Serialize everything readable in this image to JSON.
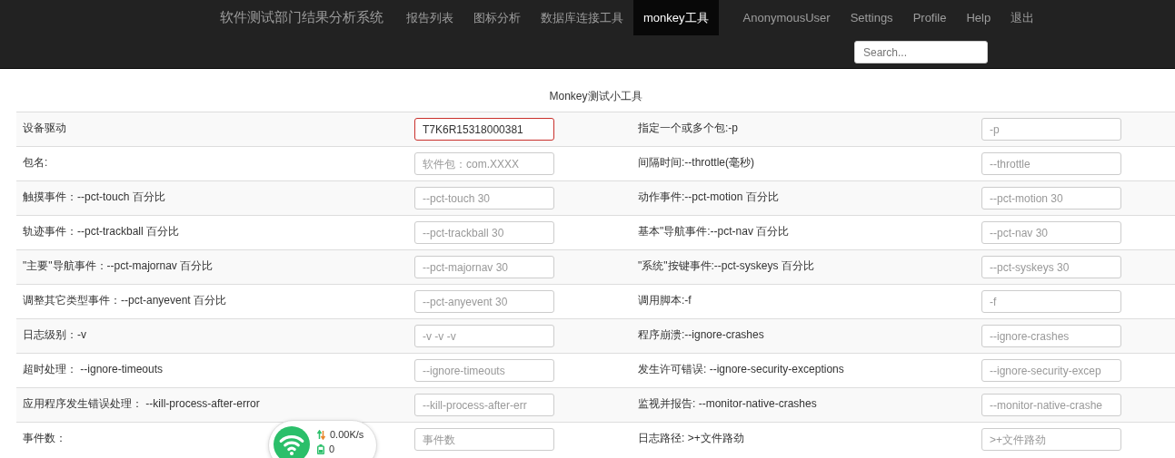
{
  "navbar": {
    "brand": "软件测试部门结果分析系统",
    "items": [
      {
        "label": "报告列表",
        "selected": false
      },
      {
        "label": "图标分析",
        "selected": false
      },
      {
        "label": "数据库连接工具",
        "selected": false
      },
      {
        "label": "monkey工具",
        "selected": true
      }
    ],
    "user_items": [
      "AnonymousUser",
      "Settings",
      "Profile",
      "Help",
      "退出"
    ],
    "search": {
      "placeholder": "Search..."
    }
  },
  "form": {
    "title": "Monkey测试小工具",
    "rows": [
      [
        {
          "label": "设备驱动",
          "value": "T7K6R15318000381",
          "highlighted": true
        },
        {
          "label": "指定一个或多个包:-p",
          "placeholder": "-p",
          "highlighted": false
        }
      ],
      [
        {
          "label": "包名:",
          "placeholder": "软件包：com.XXXX",
          "highlighted": false
        },
        {
          "label": "间隔时间:--throttle(毫秒)",
          "placeholder": "--throttle",
          "highlighted": false
        }
      ],
      [
        {
          "label": "触摸事件：--pct-touch 百分比",
          "placeholder": "--pct-touch 30",
          "highlighted": false
        },
        {
          "label": "动作事件:--pct-motion 百分比",
          "placeholder": "--pct-motion 30",
          "highlighted": false
        }
      ],
      [
        {
          "label": "轨迹事件：--pct-trackball 百分比",
          "placeholder": "--pct-trackball 30",
          "highlighted": false
        },
        {
          "label": "基本\"导航事件:--pct-nav 百分比",
          "placeholder": "--pct-nav 30",
          "highlighted": false
        }
      ],
      [
        {
          "label": "\"主要\"导航事件：--pct-majornav 百分比",
          "placeholder": "--pct-majornav 30",
          "highlighted": false
        },
        {
          "label": "\"系统\"按键事件:--pct-syskeys 百分比",
          "placeholder": "--pct-syskeys 30",
          "highlighted": false
        }
      ],
      [
        {
          "label": "调整其它类型事件：--pct-anyevent 百分比",
          "placeholder": "--pct-anyevent 30",
          "highlighted": false
        },
        {
          "label": "调用脚本:-f",
          "placeholder": "-f",
          "highlighted": false
        }
      ],
      [
        {
          "label": "日志级别：-v",
          "placeholder": "-v -v -v",
          "highlighted": false
        },
        {
          "label": "程序崩溃:--ignore-crashes",
          "placeholder": "--ignore-crashes",
          "highlighted": false
        }
      ],
      [
        {
          "label": "超时处理： --ignore-timeouts",
          "placeholder": "--ignore-timeouts",
          "highlighted": false
        },
        {
          "label": "发生许可错误: --ignore-security-exceptions",
          "placeholder": "--ignore-security-excep",
          "highlighted": false
        }
      ],
      [
        {
          "label": "应用程序发生错误处理： --kill-process-after-error",
          "placeholder": "--kill-process-after-err",
          "highlighted": false
        },
        {
          "label": "监视并报告: --monitor-native-crashes",
          "placeholder": "--monitor-native-crashe",
          "highlighted": false
        }
      ],
      [
        {
          "label": "事件数：",
          "placeholder": "事件数",
          "highlighted": false
        },
        {
          "label": "日志路径: >+文件路劲",
          "placeholder": ">+文件路劲",
          "highlighted": false
        }
      ]
    ]
  },
  "net_widget": {
    "speed": "0.00K/s",
    "count": "0"
  }
}
